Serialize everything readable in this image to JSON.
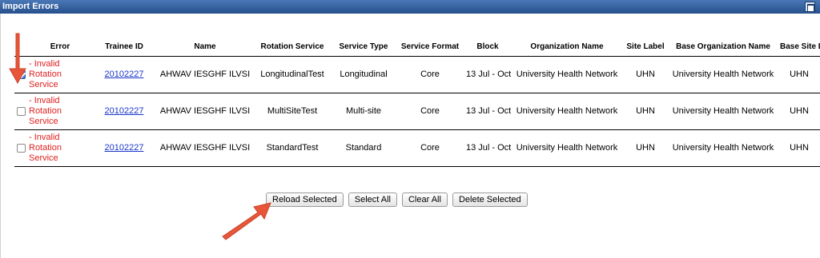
{
  "window": {
    "title": "Import Errors"
  },
  "table": {
    "headers": [
      "",
      "Error",
      "Trainee ID",
      "Name",
      "Rotation Service",
      "Service Type",
      "Service Format",
      "Block",
      "Organization Name",
      "Site Label",
      "Base Organization Name",
      "Base Site Label"
    ],
    "rows": [
      {
        "checked": true,
        "error": "- Invalid Rotation Service",
        "trainee_id": "20102227",
        "name": "AHWAV IESGHF ILVSI",
        "rotation_service": "LongitudinalTest",
        "service_type": "Longitudinal",
        "service_format": "Core",
        "block": "13 Jul - Oct",
        "organization_name": "University Health Network",
        "site_label": "UHN",
        "base_organization_name": "University Health Network",
        "base_site_label": "UHN"
      },
      {
        "checked": false,
        "error": "- Invalid Rotation Service",
        "trainee_id": "20102227",
        "name": "AHWAV IESGHF ILVSI",
        "rotation_service": "MultiSiteTest",
        "service_type": "Multi-site",
        "service_format": "Core",
        "block": "13 Jul - Oct",
        "organization_name": "University Health Network",
        "site_label": "UHN",
        "base_organization_name": "University Health Network",
        "base_site_label": "UHN"
      },
      {
        "checked": false,
        "error": "- Invalid Rotation Service",
        "trainee_id": "20102227",
        "name": "AHWAV IESGHF ILVSI",
        "rotation_service": "StandardTest",
        "service_type": "Standard",
        "service_format": "Core",
        "block": "13 Jul - Oct",
        "organization_name": "University Health Network",
        "site_label": "UHN",
        "base_organization_name": "University Health Network",
        "base_site_label": "UHN"
      }
    ]
  },
  "buttons": {
    "reload_selected": "Reload Selected",
    "select_all": "Select All",
    "clear_all": "Clear All",
    "delete_selected": "Delete Selected"
  },
  "colors": {
    "title_bar": "#2f5c9c",
    "error_text": "#e0201f",
    "link": "#1a36c8",
    "annotation_arrow": "#e8563a"
  }
}
